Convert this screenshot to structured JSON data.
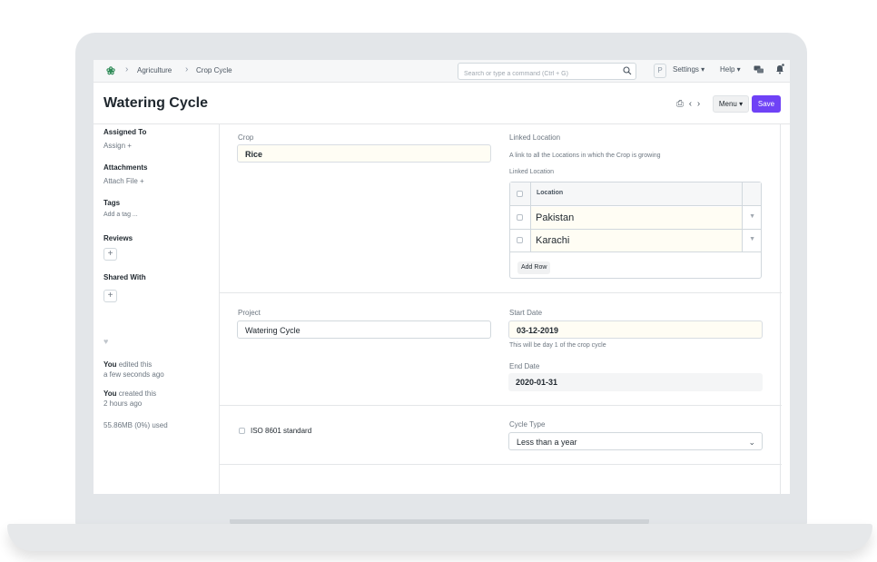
{
  "navbar": {
    "breadcrumbs": [
      "Agriculture",
      "Crop Cycle"
    ],
    "search_placeholder": "Search or type a command (Ctrl + G)",
    "avatar_letter": "P",
    "settings_label": "Settings",
    "help_label": "Help"
  },
  "header": {
    "title": "Watering Cycle",
    "menu_label": "Menu",
    "save_label": "Save"
  },
  "sidebar": {
    "assigned_to": {
      "heading": "Assigned To",
      "action": "Assign"
    },
    "attachments": {
      "heading": "Attachments",
      "action": "Attach File"
    },
    "tags": {
      "heading": "Tags",
      "action": "Add a tag ..."
    },
    "reviews": {
      "heading": "Reviews"
    },
    "shared_with": {
      "heading": "Shared With"
    },
    "activity": [
      {
        "who": "You",
        "what": "edited this",
        "when": "a few seconds ago"
      },
      {
        "who": "You",
        "what": "created this",
        "when": "2 hours ago"
      }
    ],
    "storage": "55.86MB (0%) used"
  },
  "form": {
    "crop": {
      "label": "Crop",
      "value": "Rice"
    },
    "linked_location": {
      "label": "Linked Location",
      "description": "A link to all the Locations in which the Crop is growing",
      "table_label": "Linked Location",
      "column": "Location",
      "rows": [
        "Pakistan",
        "Karachi"
      ],
      "add_row": "Add Row"
    },
    "project": {
      "label": "Project",
      "value": "Watering Cycle"
    },
    "start_date": {
      "label": "Start Date",
      "value": "03-12-2019",
      "description": "This will be day 1 of the crop cycle"
    },
    "end_date": {
      "label": "End Date",
      "value": "2020-01-31"
    },
    "iso_standard": {
      "label": "ISO 8601 standard",
      "checked": false
    },
    "cycle_type": {
      "label": "Cycle Type",
      "value": "Less than a year"
    }
  }
}
